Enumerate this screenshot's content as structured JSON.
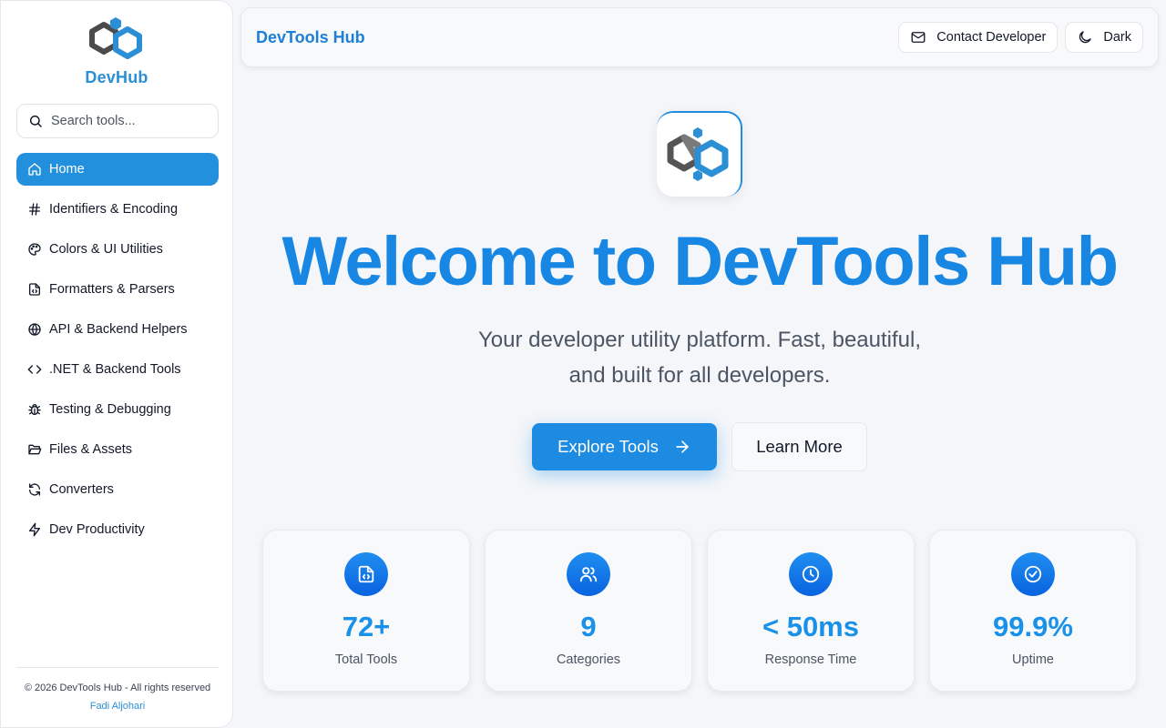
{
  "sidebar": {
    "logo_text": "DevHub",
    "search_placeholder": "Search tools...",
    "items": [
      {
        "label": "Home",
        "icon": "home-icon",
        "active": true
      },
      {
        "label": "Identifiers & Encoding",
        "icon": "hash-icon"
      },
      {
        "label": "Colors & UI Utilities",
        "icon": "palette-icon"
      },
      {
        "label": "Formatters & Parsers",
        "icon": "file-code-icon"
      },
      {
        "label": "API & Backend Helpers",
        "icon": "globe-icon"
      },
      {
        "label": ".NET & Backend Tools",
        "icon": "code-icon"
      },
      {
        "label": "Testing & Debugging",
        "icon": "bug-icon"
      },
      {
        "label": "Files & Assets",
        "icon": "folder-open-icon"
      },
      {
        "label": "Converters",
        "icon": "refresh-icon"
      },
      {
        "label": "Dev Productivity",
        "icon": "zap-icon"
      }
    ],
    "footer": {
      "copyright": "© 2026 DevTools Hub - All rights reserved",
      "author": "Fadi Aljohari"
    }
  },
  "header": {
    "brand": "DevTools Hub",
    "contact_label": "Contact Developer",
    "theme_label": "Dark"
  },
  "hero": {
    "title": "Welcome to DevTools Hub",
    "subtitle": "Your developer utility platform. Fast, beautiful, and built for all developers.",
    "primary_cta": "Explore Tools",
    "secondary_cta": "Learn More"
  },
  "stats": [
    {
      "value": "72+",
      "label": "Total Tools",
      "icon": "file-code-icon"
    },
    {
      "value": "9",
      "label": "Categories",
      "icon": "users-icon"
    },
    {
      "value": "< 50ms",
      "label": "Response Time",
      "icon": "clock-icon"
    },
    {
      "value": "99.9%",
      "label": "Uptime",
      "icon": "check-circle-icon"
    }
  ],
  "colors": {
    "accent": "#1c8be1",
    "brand_text": "#1e7fd6",
    "logo_dark": "#4b4b4b",
    "logo_blue": "#2b8fd6"
  }
}
